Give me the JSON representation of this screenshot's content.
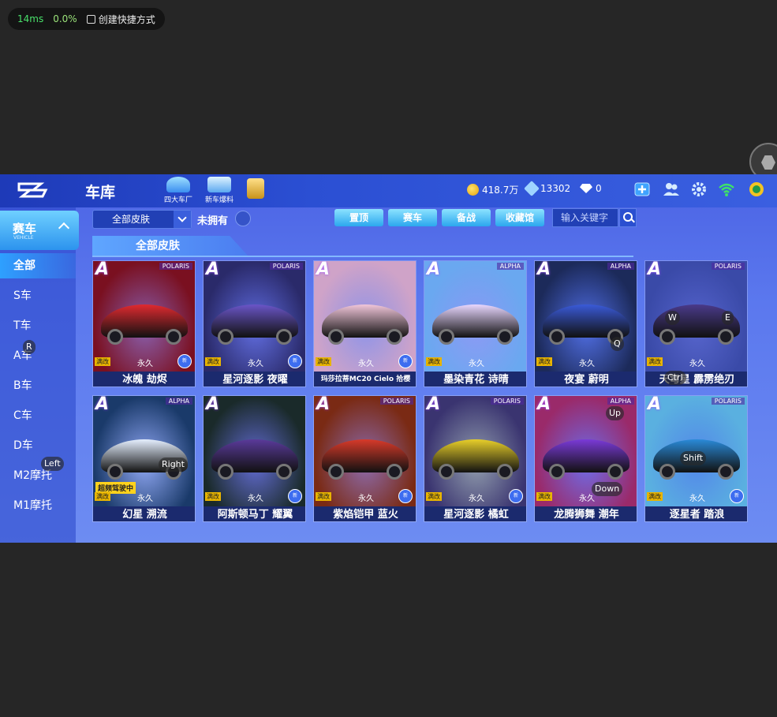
{
  "perf": {
    "ms": "14ms",
    "pct": "0.0%",
    "shortcut": "创建快捷方式"
  },
  "topbar": {
    "title": "车库",
    "icons": [
      {
        "label": "四大车厂",
        "color": "#5bc0ff"
      },
      {
        "label": "新车爆料",
        "color": "#7fd1ff"
      },
      {
        "label": "",
        "color": "#f2c24b"
      }
    ],
    "coins": "418.7万",
    "gems": "13302",
    "diamonds": "0",
    "right_icons": [
      "add-icon",
      "friends-icon",
      "gear-icon",
      "wifi-icon",
      "trophy-icon"
    ]
  },
  "sidebar": {
    "active": {
      "label": "赛车",
      "sub": "VEHICLE"
    },
    "items": [
      "全部",
      "S车",
      "T车",
      "A车",
      "B车",
      "C车",
      "D车",
      "M2摩托",
      "M1摩托"
    ]
  },
  "filter": {
    "skin": "全部皮肤",
    "owned": "未拥有"
  },
  "tabs": [
    "置顶",
    "赛车",
    "备战",
    "收藏馆"
  ],
  "search": {
    "placeholder": "输入关键字"
  },
  "section_title": "全部皮肤",
  "cards": [
    {
      "name": "冰魄 劫烬",
      "grade": "A",
      "brand": "POLARIS",
      "mod": "满改",
      "perm": "永久",
      "bg": "#7a1020",
      "car": "#e02a30",
      "new": true,
      "tag": ""
    },
    {
      "name": "星河逐影 夜曜",
      "grade": "A",
      "brand": "POLARIS",
      "mod": "满改",
      "perm": "永久",
      "bg": "#2a2a6a",
      "car": "#6a55c8",
      "new": true,
      "tag": ""
    },
    {
      "name": "玛莎拉蒂MC20 Cielo 拾樱",
      "grade": "A",
      "brand": "",
      "mod": "满改",
      "perm": "永久",
      "bg": "#cfa3c8",
      "car": "#f1c6da",
      "new": true,
      "tag": ""
    },
    {
      "name": "墨染青花 诗晴",
      "grade": "A",
      "brand": "ALPHA",
      "mod": "满改",
      "perm": "永久",
      "bg": "#6aa8f0",
      "car": "#e9d7ff",
      "new": false,
      "tag": ""
    },
    {
      "name": "夜宴 蔚明",
      "grade": "A",
      "brand": "ALPHA",
      "mod": "满改",
      "perm": "永久",
      "bg": "#1c2a5a",
      "car": "#3a5ad8",
      "new": false,
      "tag": ""
    },
    {
      "name": "天穹星 霹雳绝刃",
      "grade": "A",
      "brand": "POLARIS",
      "mod": "满改",
      "perm": "永久",
      "bg": "#3a4aa8",
      "car": "#4a3a8a",
      "new": false,
      "tag": ""
    },
    {
      "name": "幻星 溯流",
      "grade": "A",
      "brand": "ALPHA",
      "mod": "满改",
      "perm": "永久",
      "bg": "#1a3a6a",
      "car": "#e6f0ff",
      "new": false,
      "tag": "超频驾驶中"
    },
    {
      "name": "阿斯顿马丁 耀翼",
      "grade": "A",
      "brand": "",
      "mod": "满改",
      "perm": "永久",
      "bg": "#1a2a2a",
      "car": "#5a3a9a",
      "new": true,
      "tag": ""
    },
    {
      "name": "紫焰铠甲 蓝火",
      "grade": "A",
      "brand": "POLARIS",
      "mod": "满改",
      "perm": "永久",
      "bg": "#7a2a14",
      "car": "#d83a2a",
      "new": true,
      "tag": ""
    },
    {
      "name": "星河逐影 橘虹",
      "grade": "A",
      "brand": "POLARIS",
      "mod": "满改",
      "perm": "永久",
      "bg": "#3a3470",
      "car": "#e8cf2a",
      "new": true,
      "tag": ""
    },
    {
      "name": "龙腾狮舞 潮年",
      "grade": "A",
      "brand": "ALPHA",
      "mod": "满改",
      "perm": "永久",
      "bg": "#9a2a6a",
      "car": "#7a3ad8",
      "new": false,
      "tag": ""
    },
    {
      "name": "逐星者 踏浪",
      "grade": "A",
      "brand": "POLARIS",
      "mod": "满改",
      "perm": "永久",
      "bg": "#5ab0e0",
      "car": "#2a8ad8",
      "new": true,
      "tag": ""
    }
  ],
  "new_label": "新",
  "hints": [
    "R",
    "Left",
    "Right",
    "Q",
    "W",
    "E",
    "Ctrl",
    "Up",
    "Down",
    "Shift"
  ]
}
